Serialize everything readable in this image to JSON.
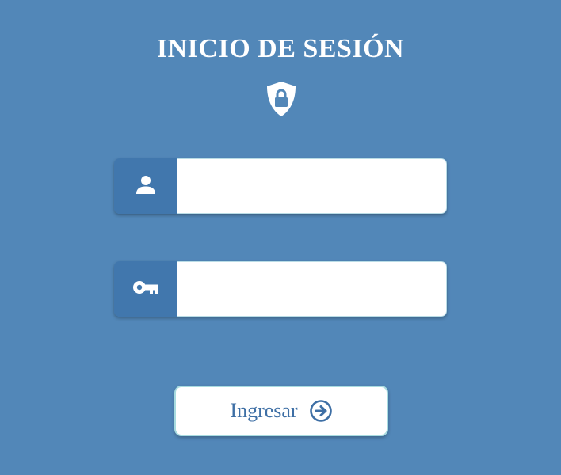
{
  "login": {
    "title": "INICIO DE SESIÓN",
    "header_icon": "shield-lock-icon",
    "username": {
      "icon": "user-icon",
      "value": "",
      "placeholder": ""
    },
    "password": {
      "icon": "key-icon",
      "value": "",
      "placeholder": ""
    },
    "submit": {
      "label": "Ingresar",
      "icon": "arrow-circle-right-icon"
    }
  },
  "colors": {
    "background": "#5287b8",
    "addon": "#4177ad",
    "input_background": "#ffffff",
    "button_text": "#3e6fa5",
    "button_border": "#a8dbe0",
    "title_text": "#ffffff"
  }
}
